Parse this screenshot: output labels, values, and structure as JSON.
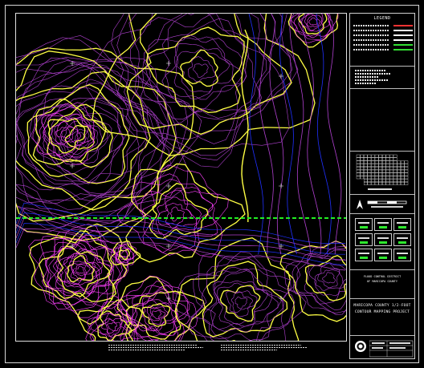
{
  "window": {
    "title": "MARICOPA COUNTY 1/2-FOOT CONTOUR MAPPING PROJECT"
  },
  "legend": {
    "title": "LEGEND",
    "items": [
      {
        "swatch_color": "#ff3333"
      },
      {
        "swatch_color": "#ffffff"
      },
      {
        "swatch_color": "#ffffff"
      },
      {
        "swatch_color": "#ffffff"
      },
      {
        "swatch_color": "#33dd33"
      },
      {
        "swatch_color": "#33dd33"
      }
    ]
  },
  "title_block": {
    "agency_line_1": "FLOOD CONTROL DISTRICT",
    "agency_line_2": "OF MARICOPA COUNTY",
    "project_line_1": "MARICOPA COUNTY 1/2-FOOT",
    "project_line_2": "CONTOUR MAPPING PROJECT"
  },
  "colors": {
    "background": "#000000",
    "index_contour": "#ffff44",
    "intermediate_contour": "#b040d0",
    "dense_contour": "#ff40ff",
    "water": "#2030ff",
    "sheet_boundary": "#22ee22",
    "frame": "#e0e0e0"
  },
  "icons": {
    "seal": "county-seal-icon",
    "north_arrow": "north-arrow-icon",
    "crosshair": "crosshair-icon"
  }
}
